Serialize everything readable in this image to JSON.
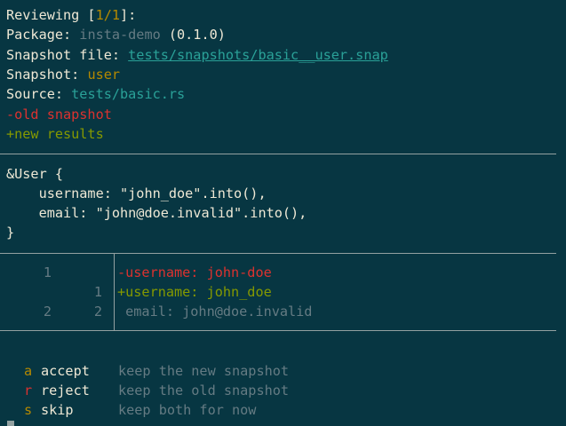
{
  "header": {
    "reviewing_label": "Reviewing [",
    "reviewing_count": "1/1",
    "reviewing_suffix": "]:",
    "package_label": "Package: ",
    "package_name": "insta-demo",
    "package_version": " (0.1.0)",
    "snapshot_file_label": "Snapshot file: ",
    "snapshot_file_path": "tests/snapshots/basic__user.snap",
    "snapshot_label": "Snapshot: ",
    "snapshot_name": "user",
    "source_label": "Source: ",
    "source_path": "tests/basic.rs",
    "old_legend": "-old snapshot",
    "new_legend": "+new results"
  },
  "expression": {
    "lines": [
      "&User {",
      "    username: \"john_doe\".into(),",
      "    email: \"john@doe.invalid\".into(),",
      "}"
    ]
  },
  "diff": {
    "rows": [
      {
        "old_no": "1",
        "new_no": "",
        "text": "-username: john-doe",
        "kind": "removed"
      },
      {
        "old_no": "",
        "new_no": "1",
        "text": "+username: john_doe",
        "kind": "added"
      },
      {
        "old_no": "2",
        "new_no": "2",
        "text": " email: john@doe.invalid",
        "kind": "context"
      }
    ]
  },
  "actions": [
    {
      "key": "a",
      "name": "accept",
      "description": "keep the new snapshot"
    },
    {
      "key": "r",
      "name": "reject",
      "description": "keep the old snapshot"
    },
    {
      "key": "s",
      "name": "skip",
      "description": "keep both for now"
    }
  ],
  "colors": {
    "background": "#073642",
    "text": "#eee8d5",
    "dim": "#657b83",
    "yellow": "#b58900",
    "cyan": "#2aa198",
    "red": "#dc322f",
    "green": "#859900"
  }
}
